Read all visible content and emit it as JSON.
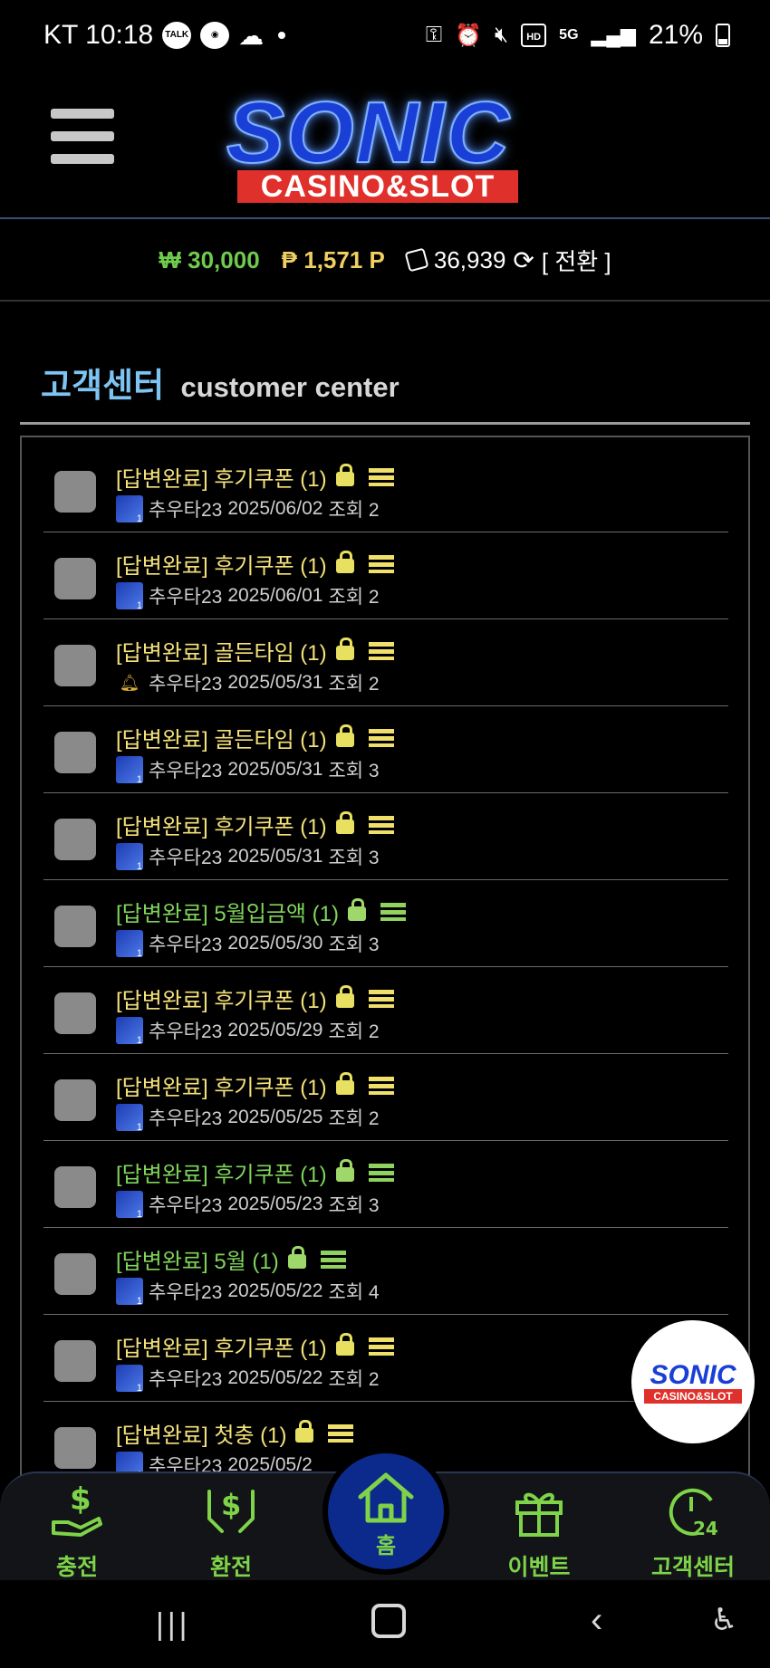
{
  "status_bar": {
    "carrier_time": "KT 10:18",
    "talk_icon_text": "TALK",
    "net_label": "5G",
    "hd_label": "HD",
    "battery": "21%"
  },
  "header": {
    "logo_title": "SONIC",
    "logo_subtitle": "CASINO&SLOT"
  },
  "balance": {
    "won": "₩ 30,000",
    "points": "₱ 1,571 P",
    "chips": "36,939",
    "convert_label": "[ 전환 ]"
  },
  "section": {
    "title_kr": "고객센터",
    "title_en": "customer center"
  },
  "posts": [
    {
      "title": "[답변완료] 후기쿠폰 (1)",
      "color": "yellow",
      "author": "추우타23",
      "date": "2025/06/02",
      "views": "조회 2",
      "icon": "avatar"
    },
    {
      "title": "[답변완료] 후기쿠폰 (1)",
      "color": "yellow",
      "author": "추우타23",
      "date": "2025/06/01",
      "views": "조회 2",
      "icon": "avatar"
    },
    {
      "title": "[답변완료] 골든타임 (1)",
      "color": "yellow",
      "author": "추우타23",
      "date": "2025/05/31",
      "views": "조회 2",
      "icon": "bell"
    },
    {
      "title": "[답변완료] 골든타임 (1)",
      "color": "yellow",
      "author": "추우타23",
      "date": "2025/05/31",
      "views": "조회 3",
      "icon": "avatar"
    },
    {
      "title": "[답변완료] 후기쿠폰 (1)",
      "color": "yellow",
      "author": "추우타23",
      "date": "2025/05/31",
      "views": "조회 3",
      "icon": "avatar"
    },
    {
      "title": "[답변완료] 5월입금액 (1)",
      "color": "green",
      "author": "추우타23",
      "date": "2025/05/30",
      "views": "조회 3",
      "icon": "avatar"
    },
    {
      "title": "[답변완료] 후기쿠폰 (1)",
      "color": "yellow",
      "author": "추우타23",
      "date": "2025/05/29",
      "views": "조회 2",
      "icon": "avatar"
    },
    {
      "title": "[답변완료] 후기쿠폰 (1)",
      "color": "yellow",
      "author": "추우타23",
      "date": "2025/05/25",
      "views": "조회 2",
      "icon": "avatar"
    },
    {
      "title": "[답변완료] 후기쿠폰 (1)",
      "color": "green",
      "author": "추우타23",
      "date": "2025/05/23",
      "views": "조회 3",
      "icon": "avatar"
    },
    {
      "title": "[답변완료] 5월 (1)",
      "color": "green",
      "author": "추우타23",
      "date": "2025/05/22",
      "views": "조회 4",
      "icon": "avatar"
    },
    {
      "title": "[답변완료] 후기쿠폰 (1)",
      "color": "yellow",
      "author": "추우타23",
      "date": "2025/05/22",
      "views": "조회 2",
      "icon": "avatar"
    },
    {
      "title": "[답변완료] 첫충 (1)",
      "color": "yellow",
      "author": "추우타23",
      "date": "2025/05/2",
      "views": "",
      "icon": "avatar"
    }
  ],
  "floating_logo": {
    "title": "SONIC",
    "subtitle": "CASINO&SLOT"
  },
  "bottom_nav": {
    "charge": "충전",
    "exchange": "환전",
    "home": "홈",
    "event": "이벤트",
    "support": "고객센터"
  },
  "colors": {
    "accent_green": "#7ed348",
    "title_yellow": "#f5e27a",
    "title_green": "#7fd55b",
    "heading_blue": "#7ec4f2",
    "home_bubble": "#0c2a8c"
  }
}
